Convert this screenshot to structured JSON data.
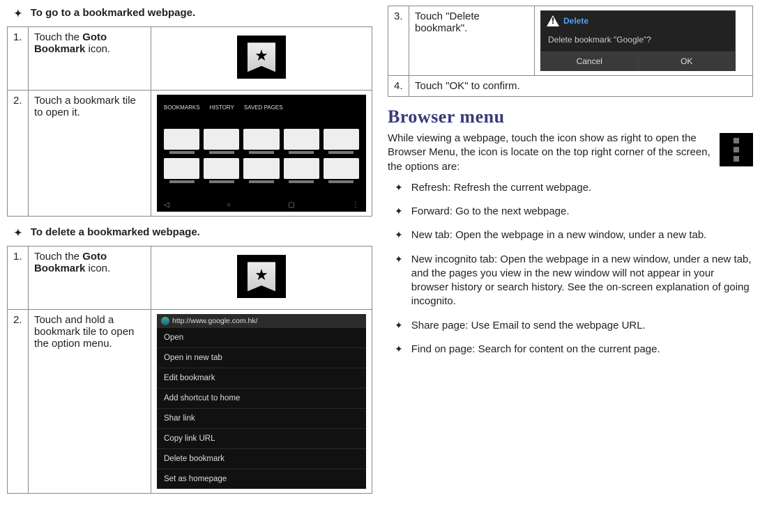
{
  "left": {
    "heading_goto": "To go to a bookmarked webpage.",
    "goto_steps": {
      "s1_num": "1.",
      "s1_text_a": "Touch the ",
      "s1_text_b": "Goto Bookmark",
      "s1_text_c": " icon.",
      "s2_num": "2.",
      "s2_text": "Touch a bookmark tile to open it."
    },
    "heading_delete": "To delete a bookmarked webpage.",
    "delete_steps": {
      "s1_num": "1.",
      "s1_text_a": "Touch the ",
      "s1_text_b": "Goto Bookmark",
      "s1_text_c": " icon.",
      "s2_num": "2.",
      "s2_text": "Touch and hold a bookmark tile to open the option menu."
    },
    "context_menu": {
      "addr": "http://www.google.com.hk/",
      "items": [
        "Open",
        "Open in new tab",
        "Edit bookmark",
        "Add shortcut to home",
        "Shar link",
        "Copy link URL",
        "Delete bookmark",
        "Set as homepage"
      ]
    }
  },
  "right": {
    "cont_steps": {
      "s3_num": "3.",
      "s3_text": "Touch \"Delete bookmark\".",
      "s4_num": "4.",
      "s4_text": "Touch \"OK\" to confirm."
    },
    "dialog": {
      "title": "Delete",
      "msg": "Delete bookmark \"Google\"?",
      "cancel": "Cancel",
      "ok": "OK"
    },
    "section_title": "Browser menu",
    "intro": "While viewing a webpage, touch the icon show as right to open the Browser Menu, the icon is locate on the top right corner of the screen, the options are:",
    "options": [
      "Refresh: Refresh the current webpage.",
      "Forward: Go to the next webpage.",
      "New tab: Open the webpage in a new window, under a new tab.",
      "New incognito tab: Open the webpage in a new win­dow, under a new tab, and the pages you view in the new window will not appear in your browser history or search history. See the on-screen explanation of going incognito.",
      "Share page: Use Email to send the webpage URL.",
      "Find on page: Search for content on the current page."
    ]
  }
}
